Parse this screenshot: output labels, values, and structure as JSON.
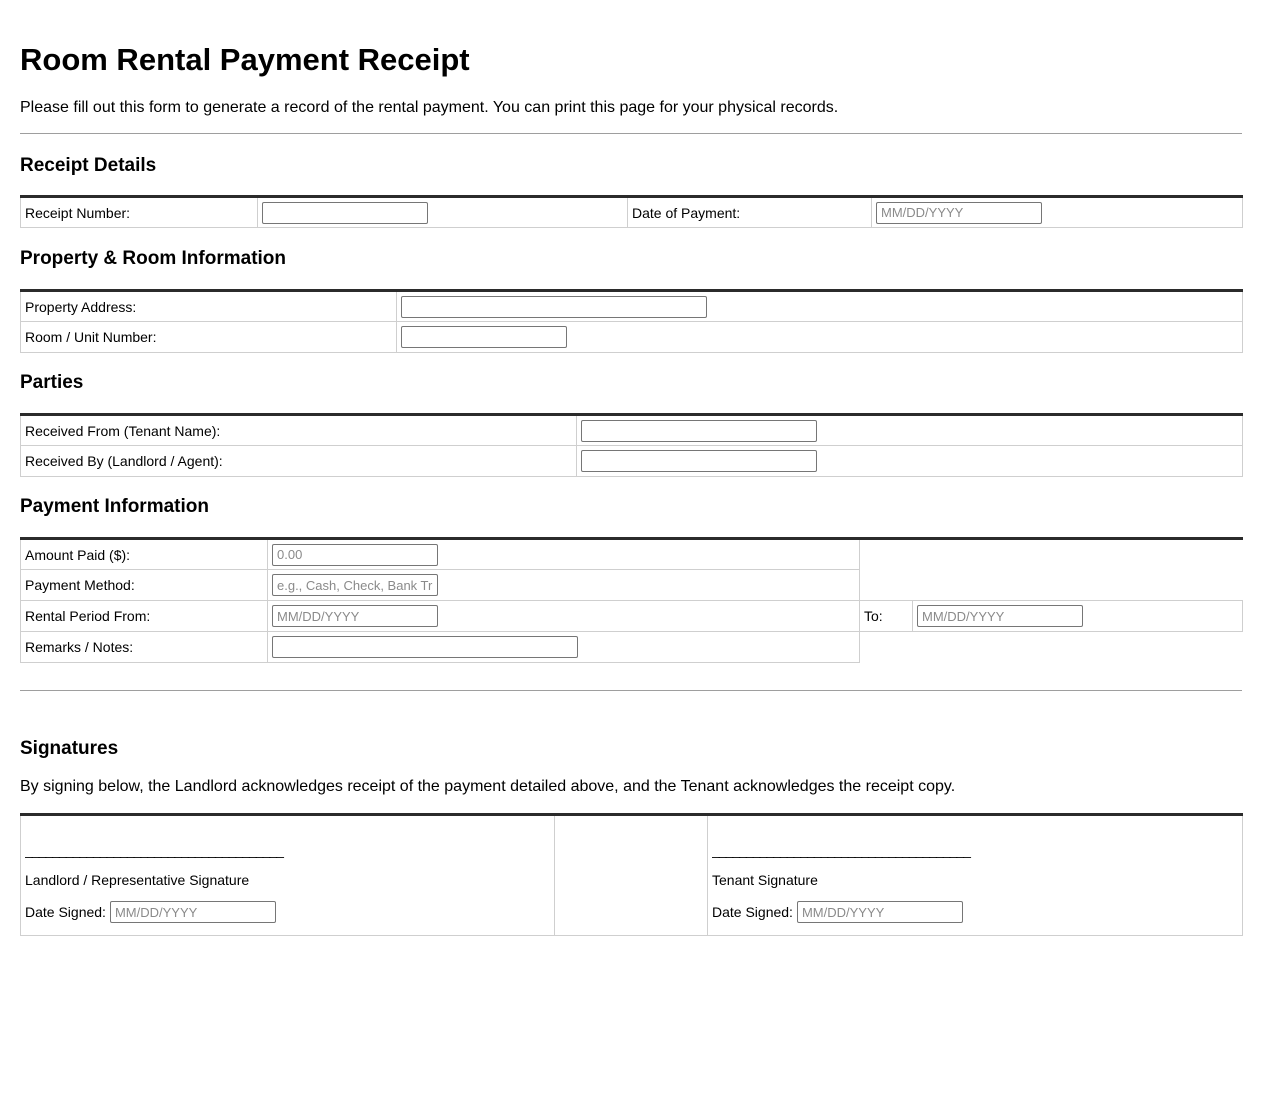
{
  "page": {
    "title": "Room Rental Payment Receipt",
    "intro": "Please fill out this form to generate a record of the rental payment. You can print this page for your physical records."
  },
  "receipt_details": {
    "heading": "Receipt Details",
    "receipt_number_label": "Receipt Number:",
    "receipt_number_value": "",
    "date_of_payment_label": "Date of Payment:",
    "date_of_payment_placeholder": "MM/DD/YYYY"
  },
  "property": {
    "heading": "Property & Room Information",
    "address_label": "Property Address:",
    "address_value": "",
    "room_label": "Room / Unit Number:",
    "room_value": ""
  },
  "parties": {
    "heading": "Parties",
    "received_from_label": "Received From (Tenant Name):",
    "received_from_value": "",
    "received_by_label": "Received By (Landlord / Agent):",
    "received_by_value": ""
  },
  "payment": {
    "heading": "Payment Information",
    "amount_label": "Amount Paid ($):",
    "amount_placeholder": "0.00",
    "method_label": "Payment Method:",
    "method_placeholder": "e.g., Cash, Check, Bank Transfer",
    "period_from_label": "Rental Period From:",
    "period_from_placeholder": "MM/DD/YYYY",
    "period_to_label": "To:",
    "period_to_placeholder": "MM/DD/YYYY",
    "remarks_label": "Remarks / Notes:",
    "remarks_value": ""
  },
  "signatures": {
    "heading": "Signatures",
    "statement": "By signing below, the Landlord acknowledges receipt of the payment detailed above, and the Tenant acknowledges the receipt copy.",
    "signature_line": "______________________________________",
    "landlord_label": "Landlord / Representative Signature",
    "landlord_date_label": "Date Signed:",
    "landlord_date_placeholder": "MM/DD/YYYY",
    "tenant_label": "Tenant Signature",
    "tenant_date_label": "Date Signed:",
    "tenant_date_placeholder": "MM/DD/YYYY"
  }
}
